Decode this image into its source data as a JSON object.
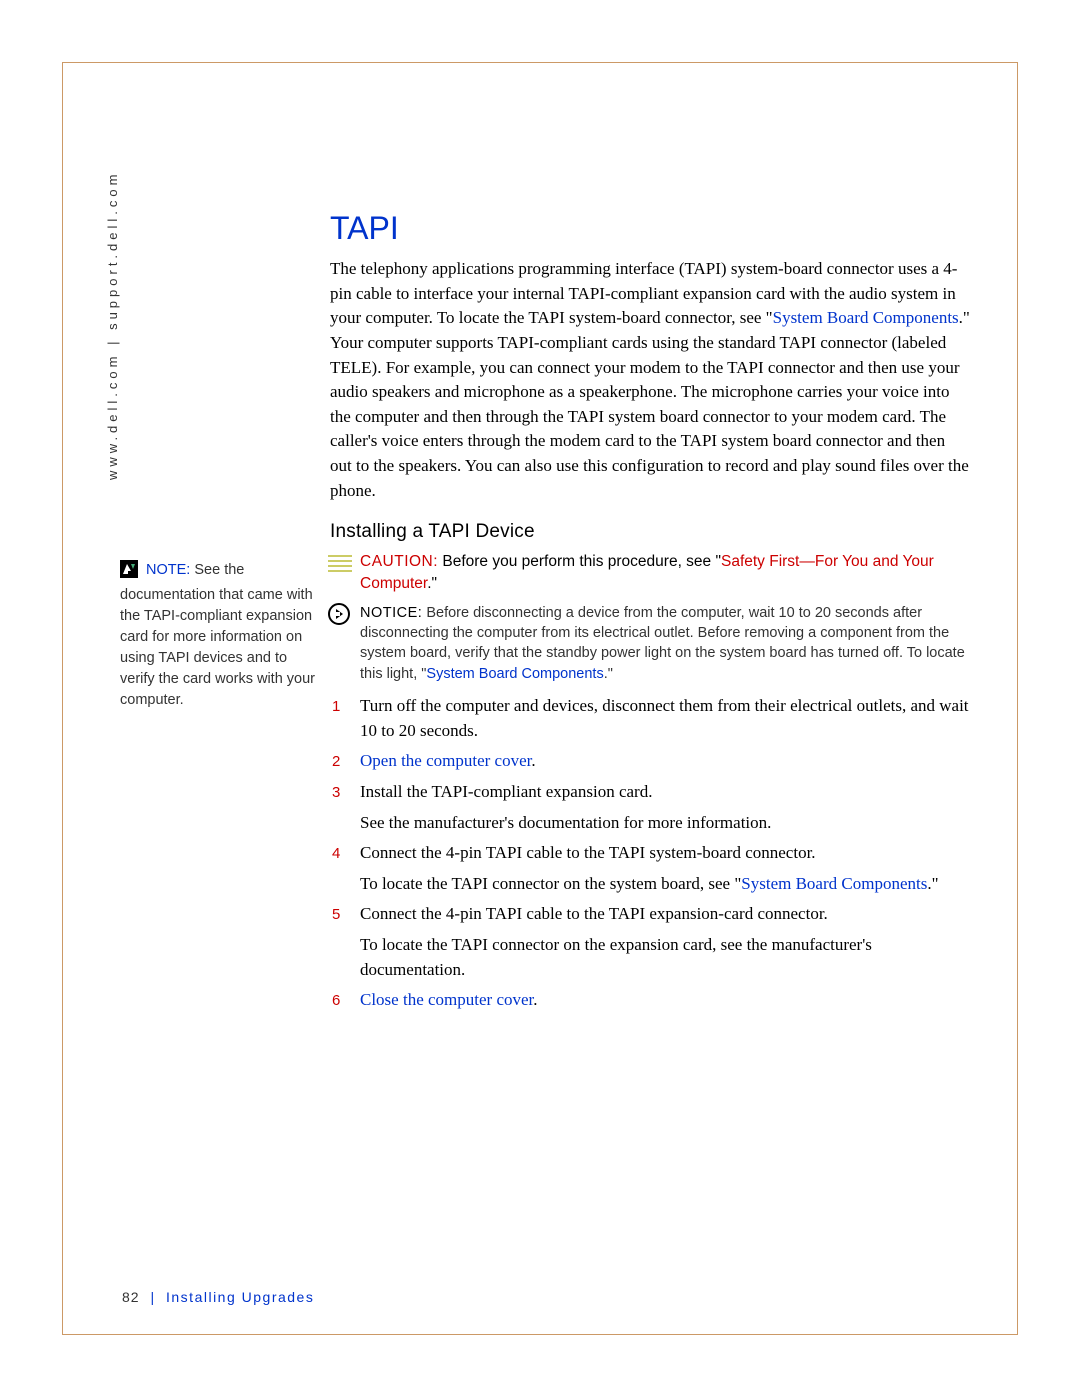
{
  "sidebar": {
    "vertical_url": "www.dell.com | support.dell.com",
    "note_label": "NOTE:",
    "note_body": " See the documentation that came with the TAPI-compliant expansion card for more information on using TAPI devices and to verify the card works with your computer."
  },
  "main": {
    "heading": "TAPI",
    "intro_part1": "The telephony applications programming interface (TAPI) system-board connector uses a 4-pin cable to interface your internal TAPI-compliant expansion card with the audio system in your computer. To locate the TAPI system-board connector, see \"",
    "intro_link1": "System Board Components",
    "intro_part2": ".\" Your computer supports TAPI-compliant cards using the standard TAPI connector (labeled TELE). For example, you can connect your modem to the TAPI connector and then use your audio speakers and microphone as a speakerphone. The microphone carries your voice into the computer and then through the TAPI system board connector to your modem card. The caller's voice enters through the modem card to the TAPI system board connector and then out to the speakers. You can also use this configuration to record and play sound files over the phone.",
    "subheading": "Installing a TAPI Device",
    "caution_label": "CAUTION:",
    "caution_body1": " Before you perform this procedure, see \"",
    "caution_link": "Safety First—For You and Your Computer",
    "caution_body2": ".\"",
    "notice_label": "NOTICE:",
    "notice_body1": " Before disconnecting a device from the computer, wait 10 to 20 seconds after disconnecting the computer from its electrical outlet. Before removing a component from the system board, verify that the standby power light on the system board has turned off. To locate this light, \"",
    "notice_link": "System Board Components",
    "notice_body2": ".\"",
    "steps": [
      {
        "n": "1",
        "text": "Turn off the computer and devices, disconnect them from their electrical outlets, and wait 10 to 20 seconds."
      },
      {
        "n": "2",
        "link": "Open the computer cover",
        "tail": "."
      },
      {
        "n": "3",
        "text": "Install the TAPI-compliant expansion card.",
        "sub": "See the manufacturer's documentation for more information."
      },
      {
        "n": "4",
        "text": "Connect the 4-pin TAPI cable to the TAPI system-board connector.",
        "sub_pre": "To locate the TAPI connector on the system board, see \"",
        "sub_link": "System Board Components",
        "sub_post": ".\""
      },
      {
        "n": "5",
        "text": "Connect the 4-pin TAPI cable to the TAPI expansion-card connector.",
        "sub": "To locate the TAPI connector on the expansion card, see the manufacturer's documentation."
      },
      {
        "n": "6",
        "link": "Close the computer cover",
        "tail": "."
      }
    ]
  },
  "footer": {
    "page_number": "82",
    "section": "Installing Upgrades"
  }
}
